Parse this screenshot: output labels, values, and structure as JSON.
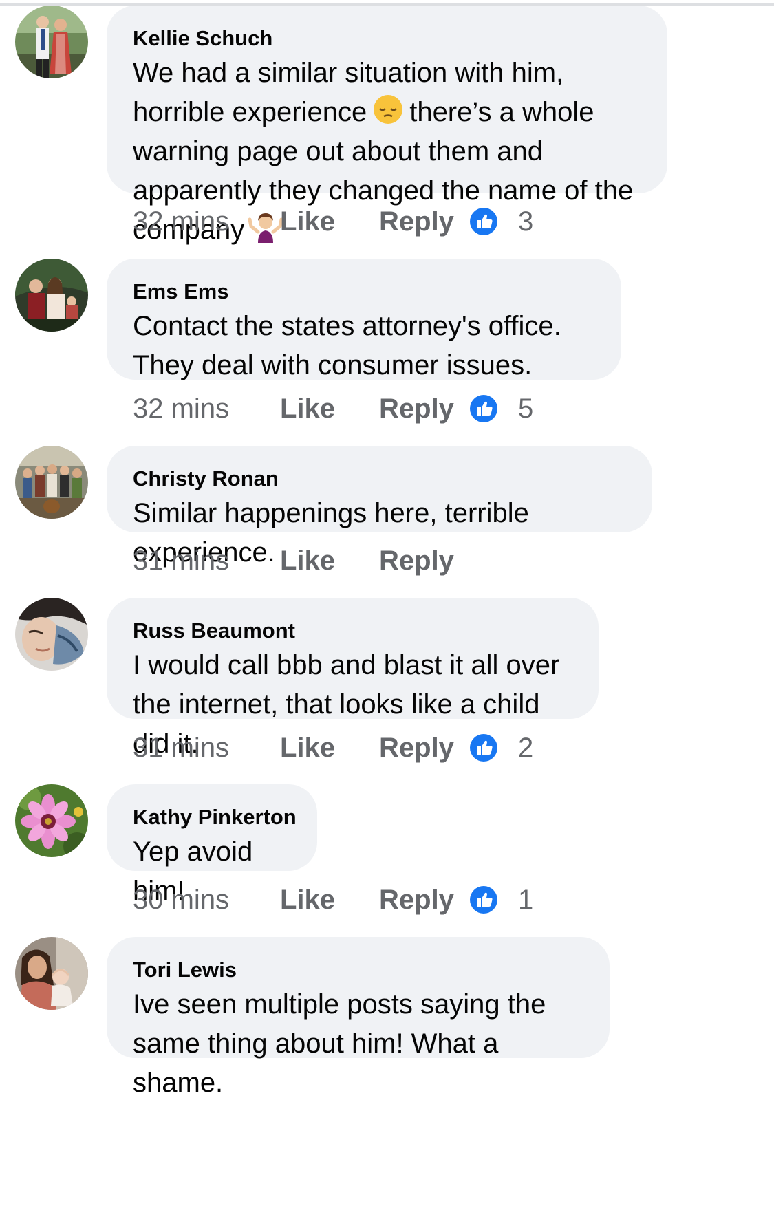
{
  "comments": [
    {
      "author": "Kellie Schuch",
      "text_parts": [
        "We had a similar situation with him, horrible experience",
        "there’s a whole warning page out about them and apparently they changed the name of the company"
      ],
      "emojis": [
        "pensive-face-emoji",
        "person-shrugging-emoji"
      ],
      "time": "32 mins",
      "like_label": "Like",
      "reply_label": "Reply",
      "reactions": "3"
    },
    {
      "author": "Ems Ems",
      "text": "Contact the states attorney's office. They deal with consumer issues.",
      "time": "32 mins",
      "like_label": "Like",
      "reply_label": "Reply",
      "reactions": "5"
    },
    {
      "author": "Christy Ronan",
      "text": "Similar happenings here, terrible experience.",
      "time": "31 mins",
      "like_label": "Like",
      "reply_label": "Reply",
      "reactions": null
    },
    {
      "author": "Russ Beaumont",
      "text": "I would call bbb and blast it all over the internet, that looks like a child did it.",
      "time": "31 mins",
      "like_label": "Like",
      "reply_label": "Reply",
      "reactions": "2"
    },
    {
      "author": "Kathy Pinkerton",
      "text": "Yep avoid him!",
      "time": "30 mins",
      "like_label": "Like",
      "reply_label": "Reply",
      "reactions": "1"
    },
    {
      "author": "Tori Lewis",
      "text": "Ive seen multiple posts saying the same thing about him! What a shame.",
      "time": "",
      "like_label": "",
      "reply_label": "",
      "reactions": null
    }
  ],
  "icons": {
    "reaction": "thumbs-up-icon"
  },
  "colors": {
    "bubble_bg": "#f0f2f5",
    "meta_text": "#65676b",
    "like_blue": "#1877f2"
  }
}
